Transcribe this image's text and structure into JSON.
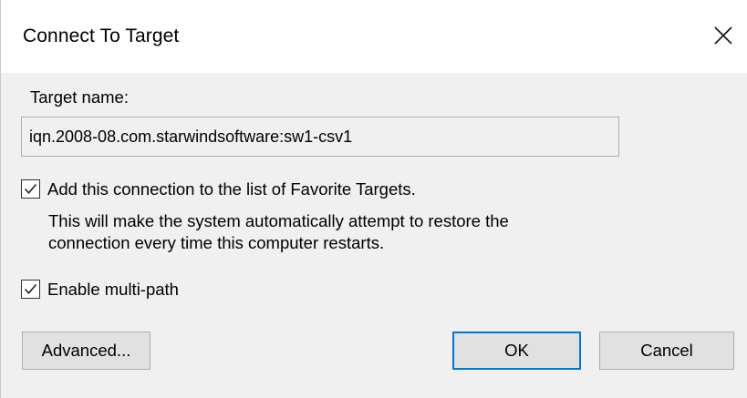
{
  "window": {
    "title": "Connect To Target",
    "close_icon": "close-icon"
  },
  "target": {
    "label": "Target name:",
    "value": "iqn.2008-08.com.starwindsoftware:sw1-csv1"
  },
  "favorites": {
    "checked": true,
    "label": "Add this connection to the list of Favorite Targets.",
    "description_line1": "This will make the system automatically attempt to restore the",
    "description_line2": "connection every time this computer restarts."
  },
  "multipath": {
    "checked": true,
    "label": "Enable multi-path"
  },
  "buttons": {
    "advanced": "Advanced...",
    "ok": "OK",
    "cancel": "Cancel"
  },
  "colors": {
    "dialog_background": "#f0f0f0",
    "titlebar_background": "#ffffff",
    "default_button_border": "#0078d7",
    "button_background": "#e1e1e1"
  }
}
